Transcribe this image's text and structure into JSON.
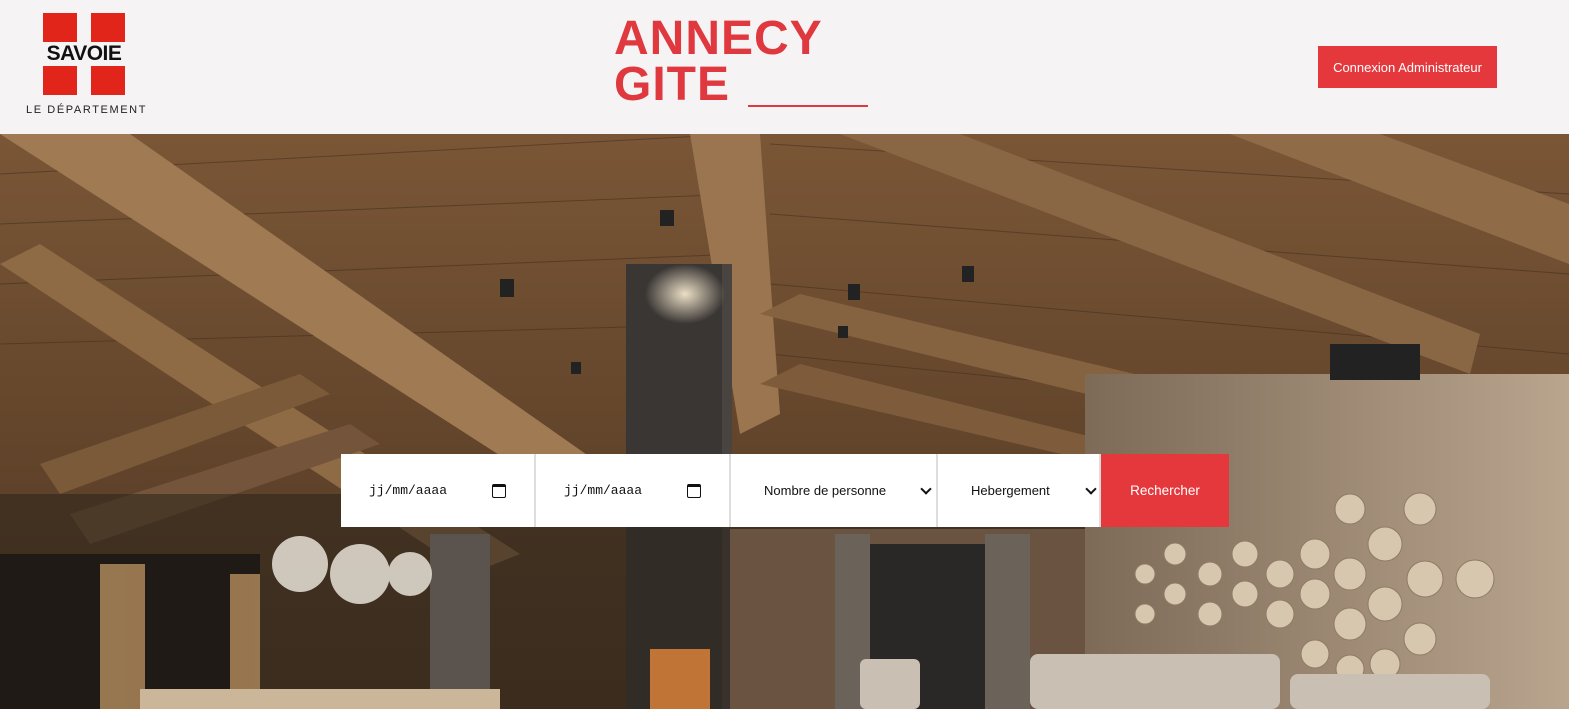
{
  "header": {
    "savoie_logo": {
      "word": "SAVOIE",
      "subtitle": "LE DÉPARTEMENT"
    },
    "annecy_logo": {
      "line1": "ANNECY",
      "line2": "GITE"
    },
    "admin_button": "Connexion Administrateur"
  },
  "search": {
    "arrival_date_placeholder": "jj/mm/aaaa",
    "departure_date_placeholder": "jj/mm/aaaa",
    "persons_select": "Nombre de personne",
    "accommodation_select": "Hebergement",
    "search_button": "Rechercher"
  },
  "colors": {
    "brand_red": "#e5383d",
    "savoie_red": "#e2251b",
    "header_bg": "#f5f3f3"
  }
}
